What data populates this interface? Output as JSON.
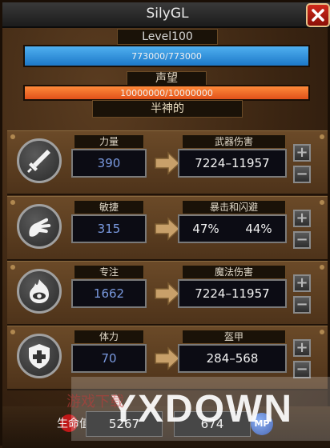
{
  "window": {
    "title": "SilyGL"
  },
  "character": {
    "level_text": "Level100",
    "hp_text": "773000/773000",
    "hp_fraction": 1.0,
    "reputation_label": "声望",
    "reputation_text": "10000000/10000000",
    "reputation_fraction": 1.0,
    "rank_title": "半神的"
  },
  "stats": [
    {
      "name": "力量",
      "value": "390",
      "result_label": "武器伤害",
      "result": "7224–11957",
      "icon": "sword-icon"
    },
    {
      "name": "敏捷",
      "value": "315",
      "result_label": "暴击和闪避",
      "result_a": "47%",
      "result_b": "44%",
      "icon": "hand-icon"
    },
    {
      "name": "专注",
      "value": "1662",
      "result_label": "魔法伤害",
      "result": "7224–11957",
      "icon": "eye-flame-icon"
    },
    {
      "name": "体力",
      "value": "70",
      "result_label": "盔甲",
      "result": "284–568",
      "icon": "shield-cross-icon"
    }
  ],
  "buttons": {
    "plus": "+",
    "minus": "−",
    "close": "close"
  },
  "bottom_bar": {
    "life_label": "生命值",
    "life_value": "5267",
    "mp_value": "674",
    "mp_orb": "MP"
  },
  "watermark": {
    "text": "YXDOWN",
    "red_text": "游戏下载"
  },
  "colors": {
    "hp": "#2d8fe0",
    "reputation": "#f07028",
    "stat_value": "#7a9ae0",
    "close": "#c82010"
  }
}
